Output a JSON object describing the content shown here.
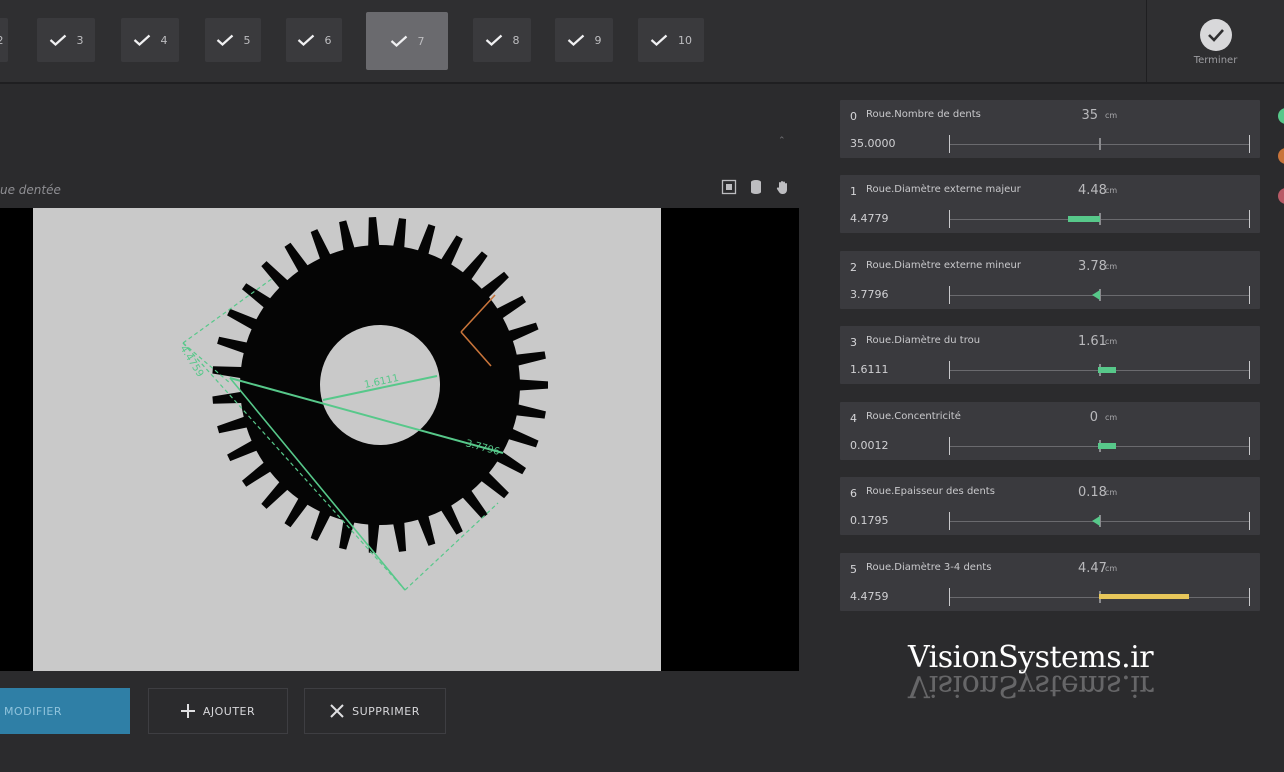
{
  "steps": [
    {
      "num": "2",
      "state": "done"
    },
    {
      "num": "3",
      "state": "done"
    },
    {
      "num": "4",
      "state": "done"
    },
    {
      "num": "5",
      "state": "done"
    },
    {
      "num": "6",
      "state": "done"
    },
    {
      "num": "7",
      "state": "active"
    },
    {
      "num": "8",
      "state": "done"
    },
    {
      "num": "9",
      "state": "done"
    },
    {
      "num": "10",
      "state": "done"
    }
  ],
  "finish": {
    "label": "Terminer",
    "icon": "check-circle-icon"
  },
  "view": {
    "title": "ue dentée",
    "tools": [
      "fit-icon",
      "cylinder-icon",
      "hand-icon"
    ],
    "annotations": {
      "inner_diameter": "1.6111",
      "outer_diameter": "3.7796",
      "tooth_span": "4.4759"
    }
  },
  "actions": {
    "modify": "MODIFIER",
    "add": "AJOUTER",
    "delete": "SUPPRIMER"
  },
  "colors": {
    "measure_green": "#57c88a",
    "measure_yellow": "#e7c65a",
    "modify_blue": "#2f7fa6",
    "annotation_orange": "#c8743a"
  },
  "measurements": [
    {
      "index": "0",
      "label": "Roue.Nombre de dents",
      "display": "35",
      "unit": "cm",
      "precise": "35.0000",
      "indicator": "none"
    },
    {
      "index": "1",
      "label": "Roue.Diamètre externe majeur",
      "display": "4.48",
      "unit": "cm",
      "precise": "4.4779",
      "indicator": "green-bar-left"
    },
    {
      "index": "2",
      "label": "Roue.Diamètre externe mineur",
      "display": "3.78",
      "unit": "cm",
      "precise": "3.7796",
      "indicator": "green-arrow"
    },
    {
      "index": "3",
      "label": "Roue.Diamètre du trou",
      "display": "1.61",
      "unit": "cm",
      "precise": "1.6111",
      "indicator": "green-bar-right"
    },
    {
      "index": "4",
      "label": "Roue.Concentricité",
      "display": "0",
      "unit": "cm",
      "precise": "0.0012",
      "indicator": "green-bar-right"
    },
    {
      "index": "6",
      "label": "Roue.Epaisseur des dents",
      "display": "0.18",
      "unit": "cm",
      "precise": "0.1795",
      "indicator": "green-arrow"
    },
    {
      "index": "5",
      "label": "Roue.Diamètre 3-4 dents",
      "display": "4.47",
      "unit": "cm",
      "precise": "4.4759",
      "indicator": "yellow-bar"
    }
  ],
  "watermark": "VisionSystems.ir"
}
